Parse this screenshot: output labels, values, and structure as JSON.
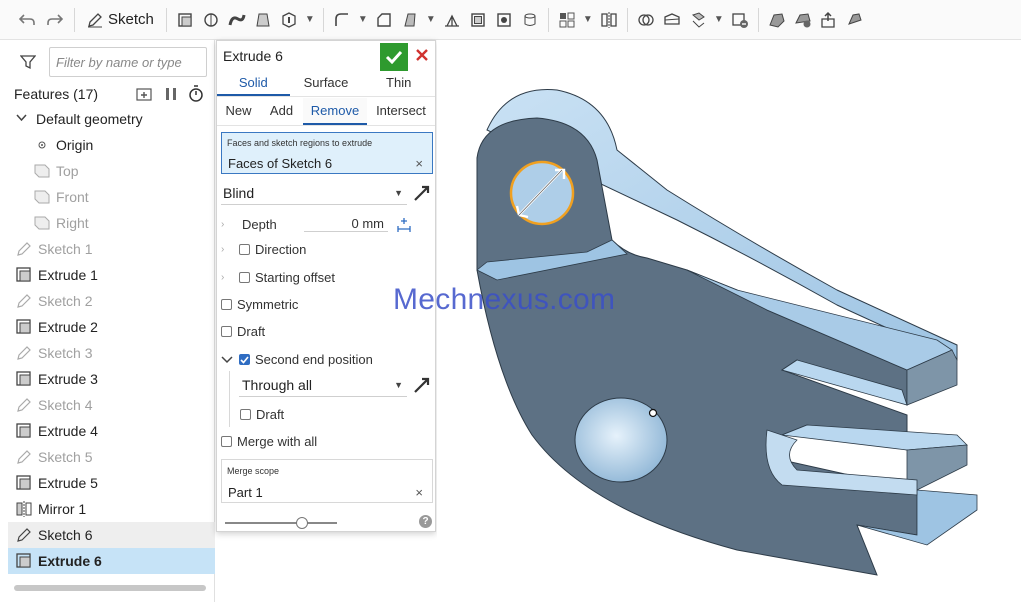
{
  "toolbar": {
    "sketch_label": "Sketch",
    "icons": [
      "undo-icon",
      "redo-icon",
      "sketch-icon",
      "extrude-icon",
      "revolve-icon",
      "sweep-icon",
      "loft-icon",
      "thicken-icon",
      "fillet-icon",
      "chamfer-icon",
      "draft-icon",
      "rib-icon",
      "shell-icon",
      "hole-icon",
      "revolve-cut-icon",
      "linear-pattern-icon",
      "mirror-icon",
      "boolean-icon",
      "split-icon",
      "transform-icon",
      "delete-part-icon",
      "modify-fillet-icon",
      "move-face-icon",
      "replace-face-icon"
    ]
  },
  "features": {
    "filter_placeholder": "Filter by name or type",
    "title": "Features (17)",
    "default_geometry": "Default geometry",
    "origin": "Origin",
    "planes": [
      "Top",
      "Front",
      "Right"
    ],
    "items": [
      {
        "label": "Sketch 1",
        "type": "sketch",
        "state": "dim"
      },
      {
        "label": "Extrude 1",
        "type": "extrude",
        "state": "normal"
      },
      {
        "label": "Sketch 2",
        "type": "sketch",
        "state": "dim"
      },
      {
        "label": "Extrude 2",
        "type": "extrude",
        "state": "normal"
      },
      {
        "label": "Sketch 3",
        "type": "sketch",
        "state": "dim"
      },
      {
        "label": "Extrude 3",
        "type": "extrude",
        "state": "normal"
      },
      {
        "label": "Sketch 4",
        "type": "sketch",
        "state": "dim"
      },
      {
        "label": "Extrude 4",
        "type": "extrude",
        "state": "normal"
      },
      {
        "label": "Sketch 5",
        "type": "sketch",
        "state": "dim"
      },
      {
        "label": "Extrude 5",
        "type": "extrude",
        "state": "normal"
      },
      {
        "label": "Mirror 1",
        "type": "mirror",
        "state": "normal"
      },
      {
        "label": "Sketch 6",
        "type": "sketch",
        "state": "hover"
      },
      {
        "label": "Extrude 6",
        "type": "extrude",
        "state": "selected"
      }
    ]
  },
  "dialog": {
    "title": "Extrude 6",
    "body_tabs": [
      "Solid",
      "Surface",
      "Thin"
    ],
    "active_body_tab": "Solid",
    "op_tabs": [
      "New",
      "Add",
      "Remove",
      "Intersect"
    ],
    "active_op_tab": "Remove",
    "faces_label": "Faces and sketch regions to extrude",
    "faces_value": "Faces of Sketch 6",
    "end_type": "Blind",
    "depth_label": "Depth",
    "depth_value": "0 mm",
    "direction": "Direction",
    "starting_offset": "Starting offset",
    "symmetric": "Symmetric",
    "draft": "Draft",
    "second_end": "Second end position",
    "second_end_type": "Through all",
    "draft2": "Draft",
    "merge_all": "Merge with all",
    "scope_label": "Merge scope",
    "scope_value": "Part 1",
    "help": "?",
    "clear": "×"
  },
  "viewport": {
    "watermark": "Mechnexus.com",
    "part_color": "#b9d7ef",
    "part_dark": "#5d7184",
    "accent": "#1e5aa8"
  }
}
